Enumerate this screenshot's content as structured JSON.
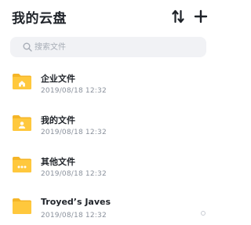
{
  "header": {
    "title": "我的云盘",
    "sort_icon": "sort-icon",
    "add_icon": "plus-icon"
  },
  "search": {
    "placeholder": "搜索文件",
    "value": ""
  },
  "colors": {
    "folder": "#ffc83d",
    "folder_tab": "#f5b528",
    "search_bg": "#f1f2f5",
    "text_primary": "#1f2329",
    "text_secondary": "#8a919c"
  },
  "files": [
    {
      "name": "企业文件",
      "date": "2019/08/18 12:32",
      "icon": "home-folder-icon"
    },
    {
      "name": "我的文件",
      "date": "2019/08/18 12:32",
      "icon": "user-folder-icon"
    },
    {
      "name": "其他文件",
      "date": "2019/08/18 12:32",
      "icon": "more-folder-icon"
    },
    {
      "name": "Troyed’s Javes",
      "date": "2019/08/18 12:32",
      "icon": "folder-icon"
    }
  ]
}
